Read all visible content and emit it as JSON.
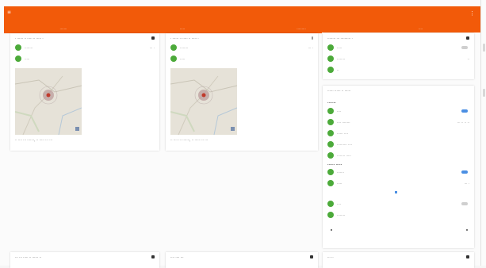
{
  "header": {
    "menu_icon": "menu-icon",
    "overflow_icon": "more-vert-icon",
    "accent": "#f25a09"
  },
  "tabs": [
    {
      "label": "·······"
    },
    {
      "label": "·····"
    },
    {
      "label": "·········"
    },
    {
      "label": "····"
    }
  ],
  "col1": {
    "card": {
      "title": "· ······ ·· ····· ·· ····· ·",
      "rows": [
        {
          "label": "········",
          "value": "··· ·"
        },
        {
          "label": "·····",
          "value": ""
        }
      ],
      "caption": "·· ···· ··· ·······, ·· ····· ··· ···"
    },
    "bottom_card": {
      "title": "··· ··· ····· ·· ······ ··"
    }
  },
  "col2": {
    "card": {
      "title": "· ······ ·· ····· ·· ····· ·",
      "rows": [
        {
          "label": "········",
          "value": "··· ·"
        },
        {
          "label": "·····",
          "value": ""
        }
      ],
      "caption": "·· ···· ··· ·······, ·· ····· ··· ···"
    },
    "bottom_card": {
      "title": "···· ···· ···"
    }
  },
  "col3": {
    "card1": {
      "title": "········ ··· ·········· ·",
      "rows": [
        {
          "label": "·····",
          "value": ""
        },
        {
          "label": "········",
          "value": "··"
        },
        {
          "label": "··",
          "value": ""
        }
      ]
    },
    "card2": {
      "title": "······ ······ ·· ······",
      "section1": "·······",
      "rows1": [
        {
          "label": "····",
          "value": ""
        },
        {
          "label": "···· ········",
          "value": "··· ·· ·· ··"
        },
        {
          "label": "······ ····",
          "value": ""
        },
        {
          "label": "·········· ····",
          "value": ""
        },
        {
          "label": "········ ·····",
          "value": ""
        }
      ],
      "section2": "······ ·····",
      "rows2": [
        {
          "label": "·······",
          "value": ""
        },
        {
          "label": "·····",
          "value": "··· ·"
        },
        {
          "label": "····",
          "value": ""
        },
        {
          "label": "········",
          "value": ""
        }
      ]
    },
    "bottom_card": {
      "title": "··· ··"
    }
  }
}
